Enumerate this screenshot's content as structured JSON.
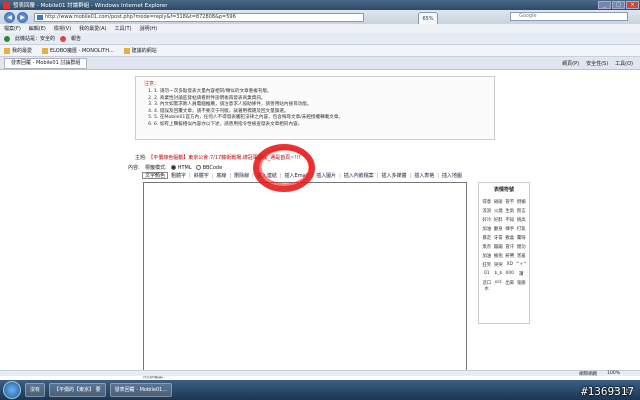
{
  "window": {
    "title": "發表回覆 - Mobile01 討論群組 - Windows Internet Explorer"
  },
  "address": {
    "url": "http://www.mobile01.com/post.php?mode=reply&f=318&t=872808&p=596",
    "tooltip": "65%",
    "search_placeholder": "Google"
  },
  "menu": {
    "items": [
      "檔案(F)",
      "編輯(E)",
      "檢視(V)",
      "我的最愛(A)",
      "工具(T)",
      "說明(H)"
    ]
  },
  "security_bar": {
    "items": [
      "此機站是：安全的",
      "報告"
    ]
  },
  "favorites": {
    "label": "我的最愛",
    "items": [
      "ELOBO魔匯 - MONOLITH...",
      "建議的網站"
    ]
  },
  "tab": {
    "label": "發表回覆 - Mobile01 討論群組",
    "tools": [
      "網頁(P)",
      "安全性(S)",
      "工具(O)"
    ]
  },
  "notice": {
    "title": "注意：",
    "items": [
      "1. 請勿一次多點發表大量內容相同/類似的文章重複刊版。",
      "2. 商業性討論區發帖請看附件說明後再發表商業資訊。",
      "3. 內文如需求教人員電腦推薦，請注意求人協助條件，請善用站內搜尋功能。",
      "4. 錯誤及回覆文章，請不要次于刊版，試著用標題及回文量篩選。",
      "5. 在Mobile01官方內，任何人不得發表觸犯法律之內容，包含侮辱文章/未經授權轉載文章。",
      "6. 如有上聲擬相似內容亦以下述，請善用指令性檢查發表文章相同內容。"
    ]
  },
  "form": {
    "subject_label": "主題:",
    "subject_value": "【平價綠色驅動】東京公會:7/17藤街戰場,總冠軍頭銜_邁是首頁~!!!",
    "content_label": "內容:",
    "mode_label": "標籤模式:",
    "mode_html": "HTML",
    "mode_bbcode": "BBCode",
    "color_select": "文字顏色",
    "toolbar_items": [
      "粗體字",
      "斜體字",
      "底線",
      "刪除線",
      "插入連結",
      "插入Email",
      "插入圖片",
      "插入內嵌檔案",
      "插入多媒體",
      "插入表格",
      "插入地圖"
    ],
    "submit_label": "附加檔案："
  },
  "smileys": {
    "title": "表情符號",
    "items": [
      "得意",
      "碰碰",
      "管不",
      "倒楣",
      "流淚",
      "火燒",
      "生氣",
      "無言",
      "好冷",
      "好醉",
      "不知",
      "挑高",
      "加油",
      "翻身",
      "揮手",
      "打氣",
      "暴走",
      "牙膏",
      "歡喜",
      "驚呀",
      "無奈",
      "蹦蹦",
      "冒汗",
      "閉功",
      "加油",
      "擁抱",
      "鼾響",
      "害羞",
      "狂笑",
      "哭哭",
      "XD",
      "^+^",
      "01",
      "$_$",
      "000",
      "讚",
      "這口水",
      "orz",
      "出來",
      "鬼臉"
    ]
  },
  "statusbar": {
    "zone": "網際網路",
    "zoom": "100%"
  },
  "taskbar": {
    "buttons": [
      "沒有",
      "【平價的【東京】 要",
      "發表回覆 - Mobile01..."
    ],
    "tray": [
      "CH",
      "上午"
    ]
  },
  "watermark": "#1369317"
}
